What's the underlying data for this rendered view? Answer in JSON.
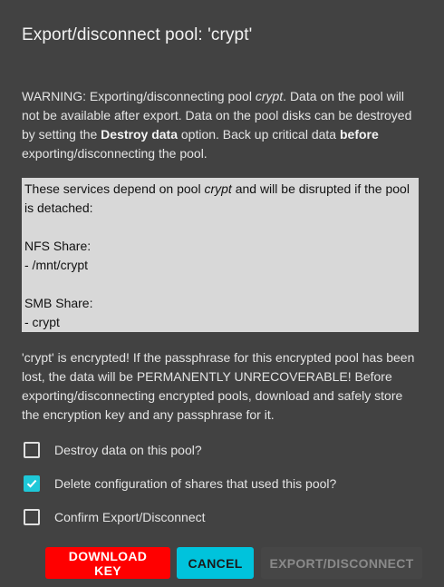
{
  "dialog": {
    "title": "Export/disconnect pool: 'crypt'",
    "warning": {
      "p1": "WARNING: Exporting/disconnecting pool ",
      "pool": "crypt",
      "p2": ". Data on the pool will not be available after export. Data on the pool disks can be destroyed by setting the ",
      "option": "Destroy data",
      "p3": " option. Back up critical data ",
      "before": "before",
      "p4": " exporting/disconnecting the pool."
    },
    "services": {
      "intro_a": "These services depend on pool ",
      "pool": "crypt",
      "intro_b": " and will be disrupted if the pool is detached:",
      "nfs_header": "NFS Share:",
      "nfs_item": "- /mnt/crypt",
      "smb_header": "SMB Share:",
      "smb_item": "- crypt"
    },
    "encrypted_notice": "'crypt' is encrypted! If the passphrase for this encrypted pool has been lost, the data will be PERMANENTLY UNRECOVERABLE! Before exporting/disconnecting encrypted pools, download and safely store the encryption key and any passphrase for it.",
    "checkboxes": [
      {
        "label": "Destroy data on this pool?",
        "checked": false
      },
      {
        "label": "Delete configuration of shares that used this pool?",
        "checked": true
      },
      {
        "label": "Confirm Export/Disconnect",
        "checked": false
      }
    ],
    "buttons": {
      "download": "DOWNLOAD KEY",
      "cancel": "CANCEL",
      "export": "EXPORT/DISCONNECT"
    },
    "colors": {
      "background": "#424242",
      "danger": "#ff0000",
      "accent": "#00c3dc",
      "disabled": "#8a8a8a"
    }
  }
}
